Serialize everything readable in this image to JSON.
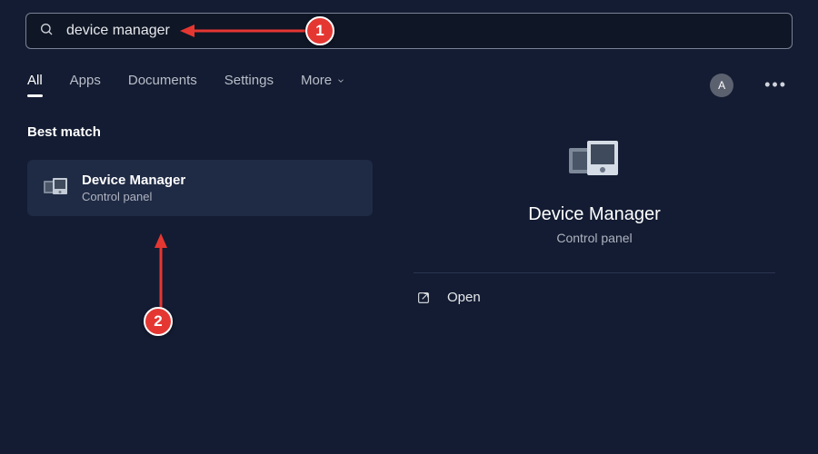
{
  "search": {
    "query": "device manager"
  },
  "tabs": {
    "items": [
      "All",
      "Apps",
      "Documents",
      "Settings",
      "More"
    ],
    "active_index": 0
  },
  "user": {
    "initial": "A"
  },
  "results": {
    "section_title": "Best match",
    "best_match": {
      "title": "Device Manager",
      "subtitle": "Control panel"
    }
  },
  "detail": {
    "title": "Device Manager",
    "subtitle": "Control panel",
    "actions": {
      "open_label": "Open"
    }
  },
  "annotations": {
    "badge1": "1",
    "badge2": "2"
  }
}
